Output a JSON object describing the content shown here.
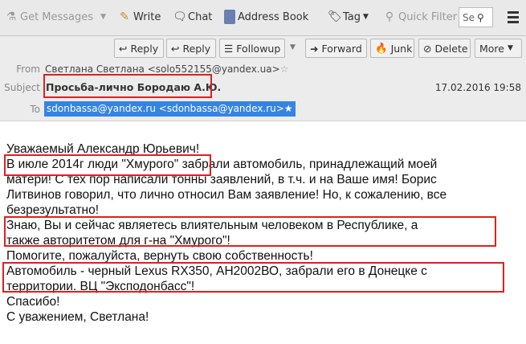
{
  "toolbar": {
    "get_messages": "Get Messages",
    "write": "Write",
    "chat": "Chat",
    "address_book": "Address Book",
    "tag": "Tag",
    "quick_filter": "Quick Filter",
    "search_placeholder": "Se"
  },
  "actions": {
    "reply": "Reply",
    "reply_all": "Reply",
    "followup": "Followup",
    "forward": "Forward",
    "junk": "Junk",
    "delete": "Delete",
    "more": "More"
  },
  "header": {
    "from_label": "From",
    "from": "Светлана Светлана <solo552155@yandex.ua>",
    "subject_label": "Subject",
    "subject": "Просьба-лично Бородаю А.Ю.",
    "date": "17.02.2016 19:58",
    "to_label": "To",
    "to": "sdonbassa@yandex.ru <sdonbassa@yandex.ru>"
  },
  "body": {
    "lines": [
      "Уважаемый Александр Юрьевич!",
      "В июле 2014г люди \"Хмурого\" забрали автомобиль, принадлежащий моей",
      "матери! С тех пор написали тонны заявлений, в т.ч. и на Ваше имя! Борис",
      "Литвинов говорил, что лично относил Вам заявление! Но, к сожалению, все",
      "безрезультатно!",
      "Знаю, Вы и сейчас являетесь влиятельным человеком в Республике, а",
      "также авторитетом для г-на \"Хмурого\"!",
      "Помогите, пожалуйста, вернуть свою собственность!",
      "Автомобиль - черный Lexus RX350, АН2002ВО, забрали его в Донецке с",
      "территории. ВЦ \"Экcподонбасс\"!",
      "Спасибо!",
      "С уважением, Светлана!"
    ]
  },
  "colors": {
    "highlight": "#3584e4",
    "annotation": "#e02020"
  }
}
